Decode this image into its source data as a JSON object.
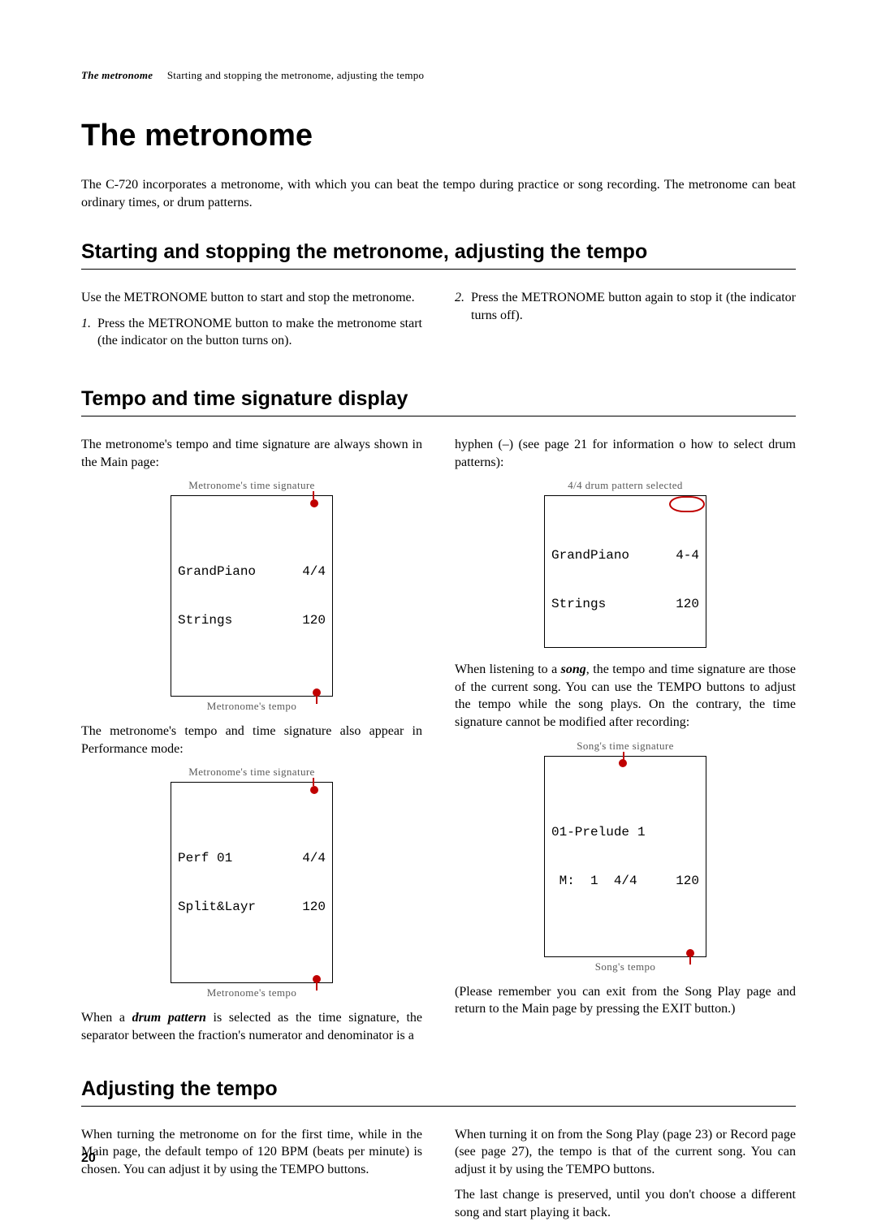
{
  "running_head": {
    "section": "The metronome",
    "subtitle": "Starting and stopping the metronome, adjusting the tempo"
  },
  "title": "The metronome",
  "intro": "The C-720 incorporates a metronome, with which you can beat the tempo during practice or song recording. The metronome can beat ordinary times, or drum patterns.",
  "section1": {
    "heading": "Starting and stopping the metronome, adjusting the tempo",
    "left_para": "Use the METRONOME button to start and stop the metronome.",
    "item1_num": "1.",
    "item1_text": "Press the METRONOME button to make the metronome start (the indicator on the button turns on).",
    "item2_num": "2.",
    "item2_text": "Press the METRONOME button again to stop it (the indicator turns off)."
  },
  "section2": {
    "heading": "Tempo and time signature display",
    "left_para1": "The metronome's tempo and time signature are always shown in the Main page:",
    "lcd1_top_label": "Metronome's time signature",
    "lcd1_row1_l": "GrandPiano",
    "lcd1_row1_r": "4/4",
    "lcd1_row2_l": "Strings",
    "lcd1_row2_r": "120",
    "lcd1_bot_label": "Metronome's tempo",
    "left_para2": "The metronome's tempo and time signature also appear in Performance mode:",
    "lcd2_top_label": "Metronome's time signature",
    "lcd2_row1_l": "Perf 01",
    "lcd2_row1_r": "4/4",
    "lcd2_row2_l": "Split&Layr",
    "lcd2_row2_r": "120",
    "lcd2_bot_label": "Metronome's tempo",
    "left_para3_a": "When a ",
    "left_para3_b": "drum pattern",
    "left_para3_c": " is selected as the time signature, the separator between the fraction's numerator and denominator is a",
    "right_para1": "hyphen (–) (see page 21 for information o how to select drum patterns):",
    "lcd3_top_label": "4/4 drum pattern selected",
    "lcd3_row1_l": "GrandPiano",
    "lcd3_row1_r": "4-4",
    "lcd3_row2_l": "Strings",
    "lcd3_row2_r": "120",
    "right_para2_a": "When listening to a ",
    "right_para2_b": "song",
    "right_para2_c": ", the tempo and time signature are those of the current song. You can use the TEMPO buttons to adjust the tempo while the song plays. On the contrary, the time signature cannot be modified after recording:",
    "lcd4_top_label": "Song's time signature",
    "lcd4_row1_l": "01-Prelude",
    "lcd4_row1_r": "1",
    "lcd4_row2_l": " M:  1  4/4",
    "lcd4_row2_r": "120",
    "lcd4_bot_label": "Song's tempo",
    "right_para3": "(Please remember you can exit from the Song Play page and return to the Main page by pressing the EXIT button.)"
  },
  "section3": {
    "heading": "Adjusting the tempo",
    "left_para": "When turning the metronome on for the first time, while in the Main page, the default tempo of 120 BPM (beats per minute) is chosen. You can adjust it by using the TEMPO buttons.",
    "right_para1": "When turning it on from the Song Play (page 23) or Record page (see page 27), the tempo is that of the current song. You can adjust it by using the TEMPO buttons.",
    "right_para2": "The last change is preserved, until you don't choose a different song and start playing it back."
  },
  "page_number": "20"
}
